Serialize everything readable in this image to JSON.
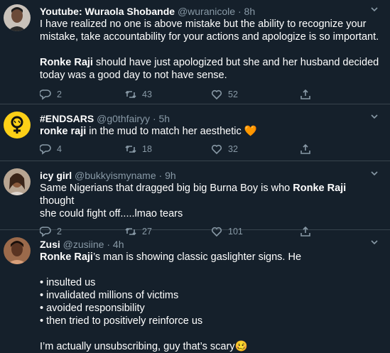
{
  "tweets": [
    {
      "name": "Youtube: Wuraola Shobande",
      "handle": "@wuranicole",
      "time": "8h",
      "body_1": "I have realized no one is above mistake but the ability to recognize your",
      "body_2": "mistake, take accountability for your actions and apologize is so important.",
      "body_3_bold": "Ronke Raji",
      "body_3": " should have just apologized but she and her husband decided",
      "body_4": "today was a good day to not have sense.",
      "replies": "2",
      "retweets": "43",
      "likes": "52"
    },
    {
      "name": "#ENDSARS",
      "handle": "@g0thfairyy",
      "time": "5h",
      "body_bold": "ronke raji",
      "body": " in the mud to match her aesthetic",
      "emoji": "🧡",
      "replies": "4",
      "retweets": "18",
      "likes": "32"
    },
    {
      "name": "icy girl",
      "handle": "@bukkyismyname",
      "time": "9h",
      "body_1a": "Same Nigerians that dragged big big Burna Boy is who ",
      "body_1_bold": "Ronke Raji",
      "body_1b": " thought",
      "body_2": "she could fight off.....lmao tears",
      "replies": "2",
      "retweets": "27",
      "likes": "101"
    },
    {
      "name": "Zusi",
      "handle": "@zusiine",
      "time": "4h",
      "body_bold": "Ronke Raji",
      "body_1": "’s man is showing classic gaslighter signs. He",
      "bullets": [
        "• insulted us",
        "• invalidated millions of victims",
        "• avoided responsibility",
        "• then tried to positively reinforce us"
      ],
      "closing": "I’m actually unsubscribing, guy that’s scary",
      "emoji": "🥴"
    }
  ],
  "separator": "·",
  "icons": {
    "reply": "reply-icon",
    "retweet": "retweet-icon",
    "like": "heart-icon",
    "share": "share-icon",
    "more": "chevron-down-icon"
  },
  "colors": {
    "background": "#15202b",
    "border": "#38444d",
    "secondary_text": "#8899a6",
    "endsars_avatar": "#fdd017"
  }
}
